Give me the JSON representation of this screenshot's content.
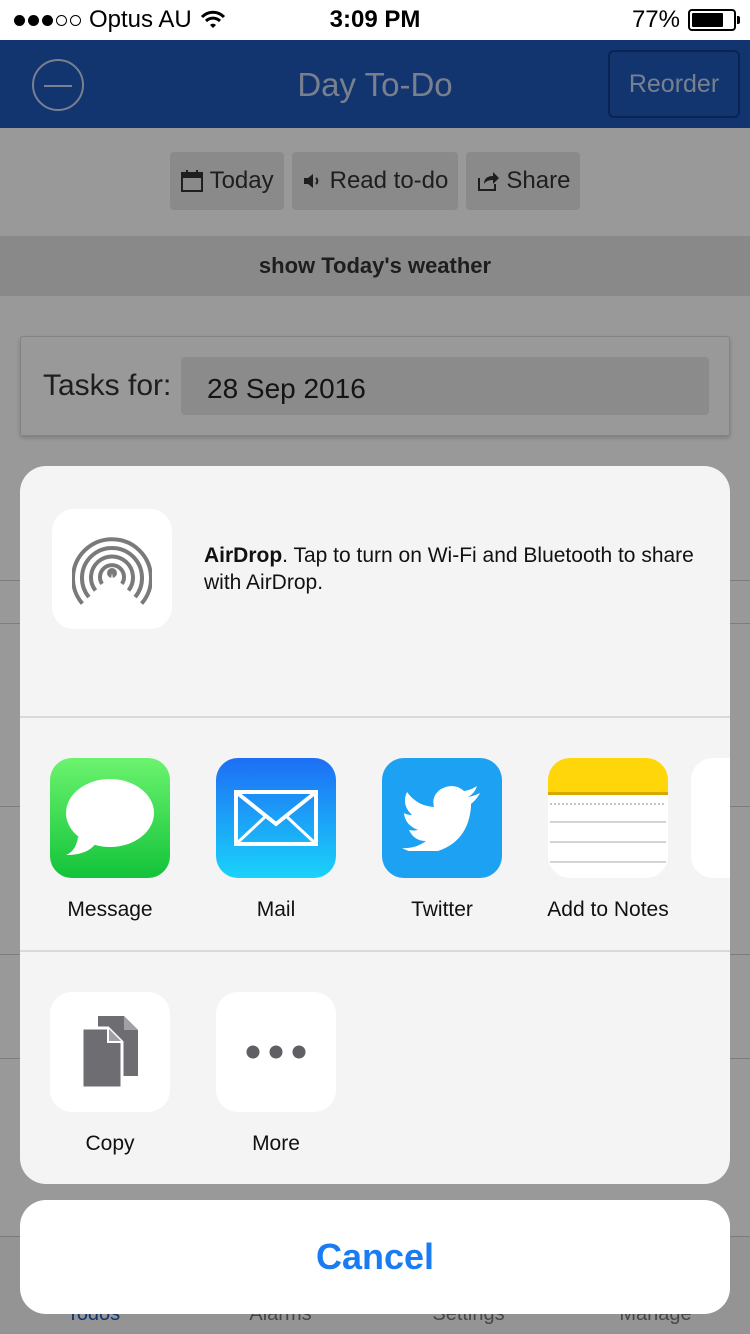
{
  "status_bar": {
    "carrier": "Optus AU",
    "time": "3:09 PM",
    "battery": "77%",
    "battery_level": 0.77,
    "signal_bars_filled": 3,
    "signal_bars_total": 5
  },
  "nav": {
    "title": "Day To-Do",
    "reorder_label": "Reorder",
    "minus_icon": "minus-circle-icon"
  },
  "toolbar": {
    "today_label": "Today",
    "read_label": "Read to-do",
    "share_label": "Share"
  },
  "weather": {
    "label": "show Today's weather"
  },
  "tasks": {
    "label": "Tasks for:",
    "date": "28 Sep 2016"
  },
  "tabs": [
    {
      "label": "Todos"
    },
    {
      "label": "Alarms"
    },
    {
      "label": "Settings"
    },
    {
      "label": "Manage"
    }
  ],
  "share_sheet": {
    "airdrop": {
      "title": "AirDrop",
      "description": ". Tap to turn on Wi-Fi and Bluetooth to share with AirDrop.",
      "icon": "airdrop-icon"
    },
    "apps": [
      {
        "label": "Message",
        "icon": "message-icon",
        "color": "#2fcb4c"
      },
      {
        "label": "Mail",
        "icon": "mail-icon",
        "color": "#1a8cf3"
      },
      {
        "label": "Twitter",
        "icon": "twitter-icon",
        "color": "#1da1f2"
      },
      {
        "label": "Add to Notes",
        "icon": "notes-icon",
        "color": "#ffcc00"
      }
    ],
    "actions": [
      {
        "label": "Copy",
        "icon": "copy-icon"
      },
      {
        "label": "More",
        "icon": "more-icon"
      }
    ],
    "cancel_label": "Cancel"
  },
  "colors": {
    "nav_bar": "#1e58b9",
    "cancel_text": "#1a7cf2",
    "sheet_background": "#f4f4f4"
  }
}
